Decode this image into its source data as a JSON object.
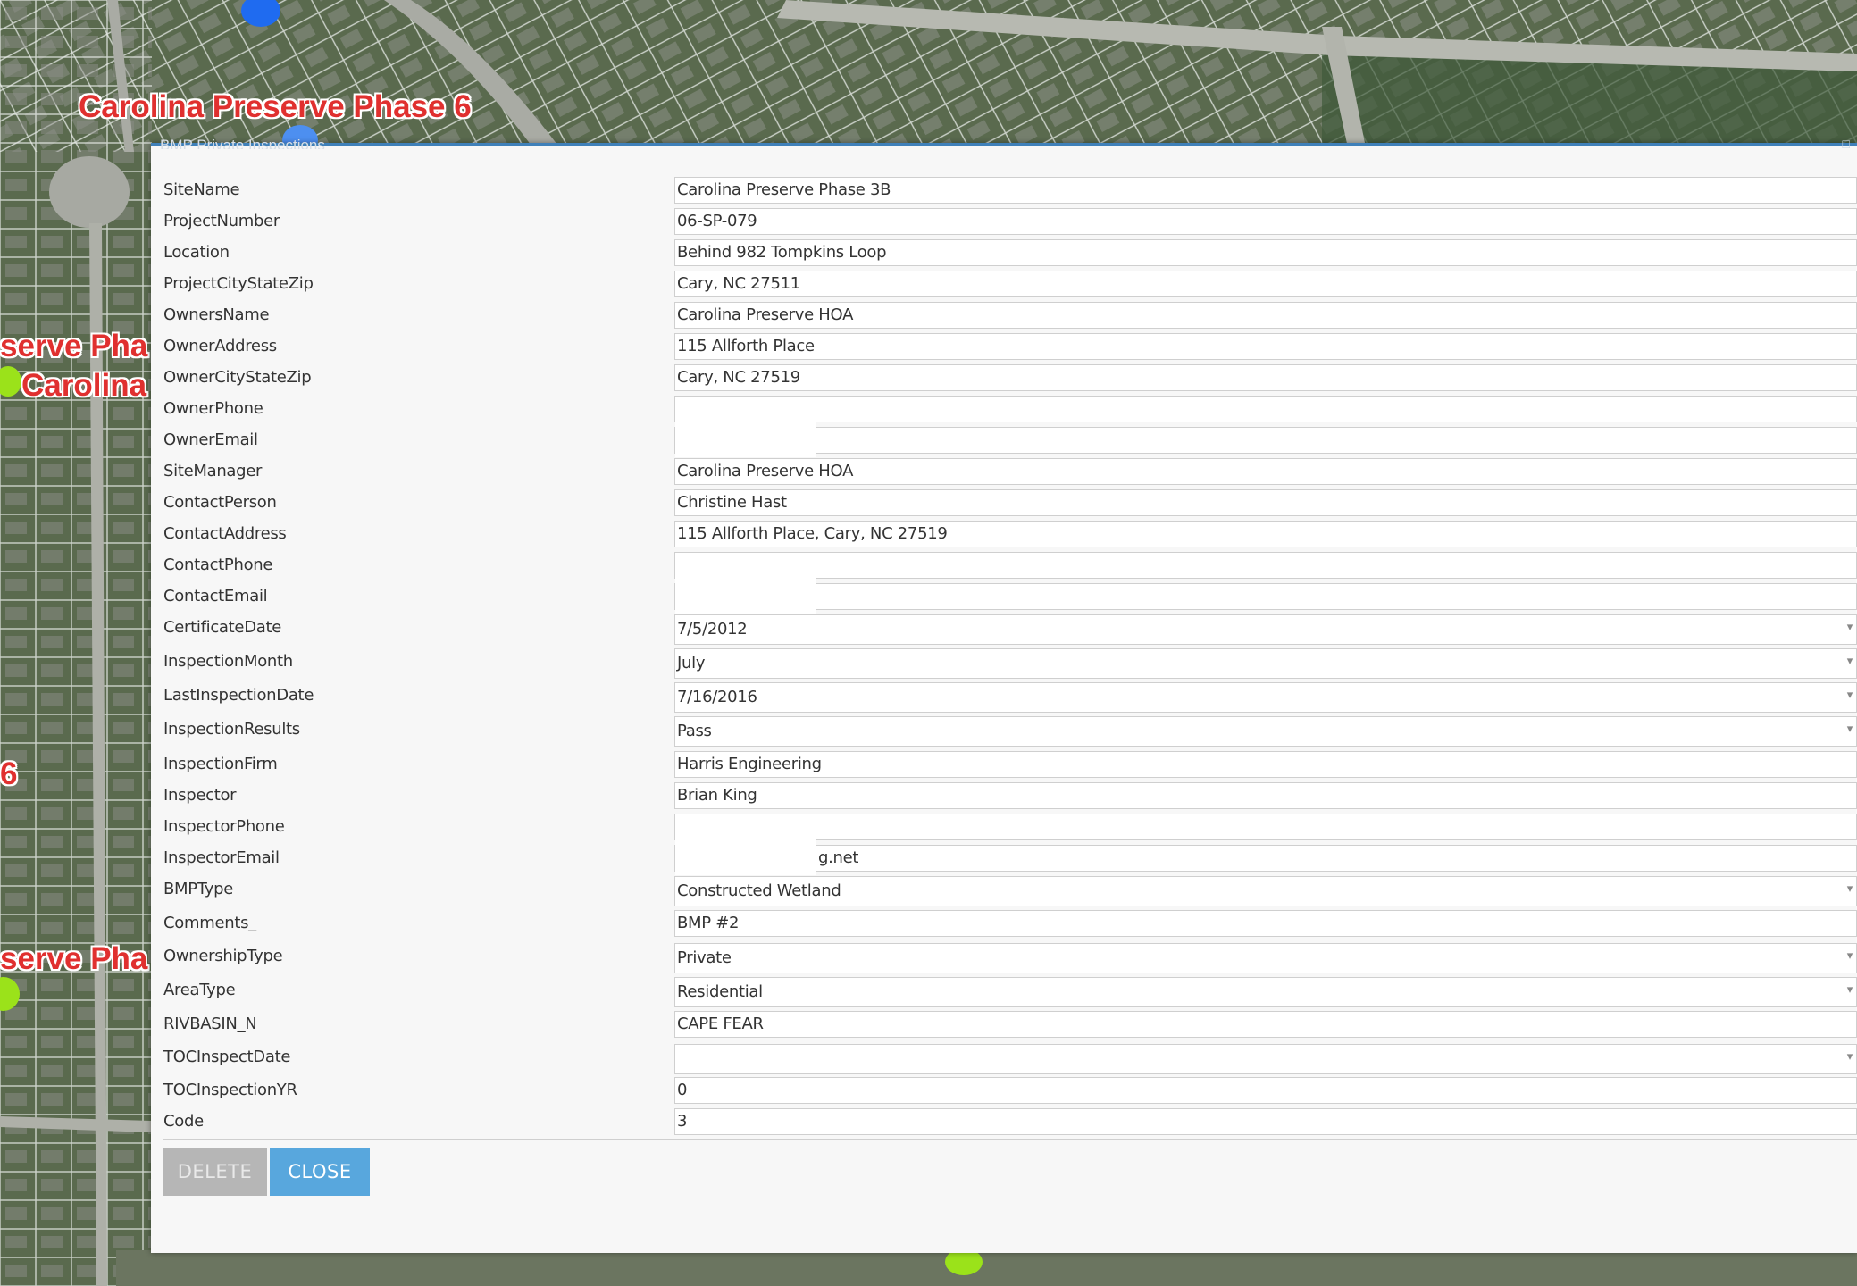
{
  "map": {
    "labels": [
      {
        "text": "Carolina Preserve Phase 6"
      },
      {
        "text": "serve Pha"
      },
      {
        "text": "Carolina"
      },
      {
        "text": "6"
      },
      {
        "text": "serve Pha"
      }
    ],
    "colors": {
      "label": "#e0302f",
      "dot_blue": "#1f6bf0",
      "dot_green": "#9be21a"
    }
  },
  "dialog": {
    "title": "BMP Private Inspections",
    "fields": [
      {
        "label": "SiteName",
        "value": "Carolina Preserve Phase 3B"
      },
      {
        "label": "ProjectNumber",
        "value": "06-SP-079"
      },
      {
        "label": "Location",
        "value": "Behind 982 Tompkins Loop"
      },
      {
        "label": "ProjectCityStateZip",
        "value": "Cary, NC 27511"
      },
      {
        "label": "OwnersName",
        "value": "Carolina Preserve HOA"
      },
      {
        "label": "OwnerAddress",
        "value": "115 Allforth Place"
      },
      {
        "label": "OwnerCityStateZip",
        "value": "Cary, NC 27519"
      },
      {
        "label": "OwnerPhone",
        "value": ""
      },
      {
        "label": "OwnerEmail",
        "value": ""
      },
      {
        "label": "SiteManager",
        "value": "Carolina Preserve HOA"
      },
      {
        "label": "ContactPerson",
        "value": "Christine Hast"
      },
      {
        "label": "ContactAddress",
        "value": "115 Allforth Place, Cary, NC 27519"
      },
      {
        "label": "ContactPhone",
        "value": ""
      },
      {
        "label": "ContactEmail",
        "value": ""
      },
      {
        "label": "CertificateDate",
        "value": "7/5/2012"
      },
      {
        "label": "InspectionMonth",
        "value": "July"
      },
      {
        "label": "LastInspectionDate",
        "value": "7/16/2016"
      },
      {
        "label": "InspectionResults",
        "value": "Pass"
      },
      {
        "label": "InspectionFirm",
        "value": "Harris Engineering"
      },
      {
        "label": "Inspector",
        "value": "Brian King"
      },
      {
        "label": "InspectorPhone",
        "value": ""
      },
      {
        "label": "InspectorEmail",
        "value": "g.net"
      },
      {
        "label": "BMPType",
        "value": "Constructed Wetland"
      },
      {
        "label": "Comments_",
        "value": "BMP #2"
      },
      {
        "label": "OwnershipType",
        "value": "Private"
      },
      {
        "label": "AreaType",
        "value": "Residential"
      },
      {
        "label": "RIVBASIN_N",
        "value": "CAPE FEAR"
      },
      {
        "label": "TOCInspectDate",
        "value": ""
      },
      {
        "label": "TOCInspectionYR",
        "value": "0"
      },
      {
        "label": "Code",
        "value": "3"
      }
    ],
    "buttons": {
      "delete": "DELETE",
      "close": "CLOSE"
    },
    "colors": {
      "header": "#3f80b9",
      "close_button": "#58a7dd",
      "delete_button": "#b6b6b6"
    }
  }
}
